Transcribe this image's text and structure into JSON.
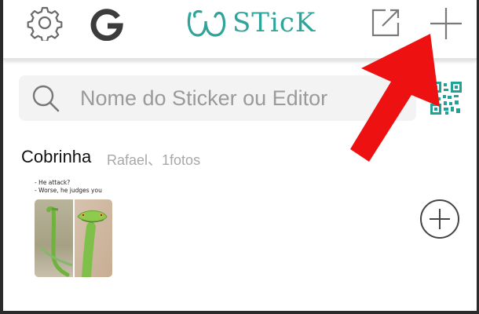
{
  "header": {
    "brand": "STicK",
    "brand_script_letter": "W",
    "icons": [
      "gear-icon",
      "google-g-icon",
      "share-icon",
      "plus-icon"
    ],
    "accent_color": "#2fa49a"
  },
  "search": {
    "placeholder": "Nome do Sticker ou Editor",
    "icon": "search-icon",
    "qr_icon": "qr-code-icon"
  },
  "pack": {
    "title": "Cobrinha",
    "meta": "Rafael、1fotos",
    "sticker_caption": [
      "- He attack?",
      "- Worse, he judges you"
    ],
    "add_icon": "add-circle-icon"
  },
  "overlay": {
    "arrow_color": "#ee1111"
  }
}
